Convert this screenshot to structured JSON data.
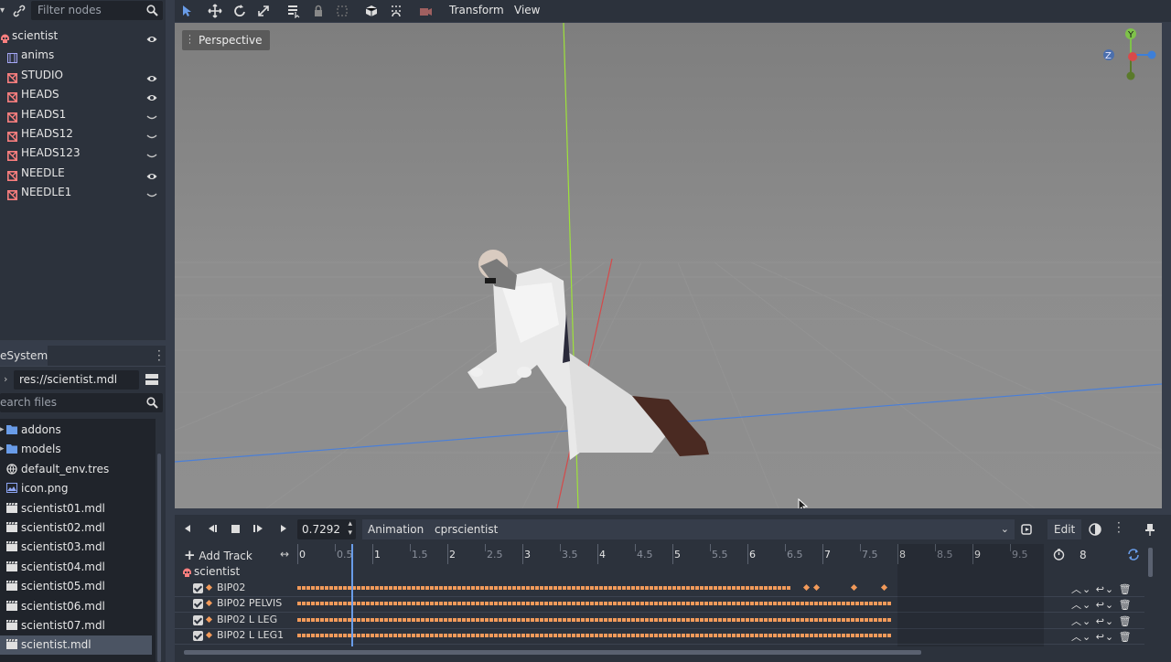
{
  "scene": {
    "filter_placeholder": "Filter nodes",
    "nodes": [
      {
        "label": "scientist",
        "icon": "skeleton-icon",
        "vis": "eye"
      },
      {
        "label": "anims",
        "icon": "animation-player-icon",
        "vis": ""
      },
      {
        "label": "STUDIO",
        "icon": "mesh-icon",
        "vis": "eye"
      },
      {
        "label": "HEADS",
        "icon": "mesh-icon",
        "vis": "eye"
      },
      {
        "label": "HEADS1",
        "icon": "mesh-icon",
        "vis": "hidden"
      },
      {
        "label": "HEADS12",
        "icon": "mesh-icon",
        "vis": "hidden"
      },
      {
        "label": "HEADS123",
        "icon": "mesh-icon",
        "vis": "hidden"
      },
      {
        "label": "NEEDLE",
        "icon": "mesh-icon",
        "vis": "eye"
      },
      {
        "label": "NEEDLE1",
        "icon": "mesh-icon",
        "vis": "hidden"
      }
    ]
  },
  "filesystem": {
    "tab": "eSystem",
    "path": "res://scientist.mdl",
    "search_placeholder": "earch files",
    "items": [
      {
        "label": "addons",
        "type": "folder",
        "selected": false
      },
      {
        "label": "models",
        "type": "folder",
        "selected": false
      },
      {
        "label": "default_env.tres",
        "type": "resource",
        "selected": false
      },
      {
        "label": "icon.png",
        "type": "image",
        "selected": false
      },
      {
        "label": "scientist01.mdl",
        "type": "scene",
        "selected": false
      },
      {
        "label": "scientist02.mdl",
        "type": "scene",
        "selected": false
      },
      {
        "label": "scientist03.mdl",
        "type": "scene",
        "selected": false
      },
      {
        "label": "scientist04.mdl",
        "type": "scene",
        "selected": false
      },
      {
        "label": "scientist05.mdl",
        "type": "scene",
        "selected": false
      },
      {
        "label": "scientist06.mdl",
        "type": "scene",
        "selected": false
      },
      {
        "label": "scientist07.mdl",
        "type": "scene",
        "selected": false
      },
      {
        "label": "scientist.mdl",
        "type": "scene",
        "selected": true
      }
    ]
  },
  "viewport": {
    "menus": {
      "transform": "Transform",
      "view": "View"
    },
    "perspective_label": "Perspective",
    "gizmo": {
      "y": "Y",
      "z": "Z"
    }
  },
  "animation": {
    "time_value": "0.7292",
    "animation_label": "Animation",
    "current_animation": "cprscientist",
    "edit_label": "Edit",
    "add_track_label": "Add Track",
    "length_value": "8",
    "root_label": "scientist",
    "ticks": [
      "0",
      "0.5",
      "1",
      "1.5",
      "2",
      "2.5",
      "3",
      "3.5",
      "4",
      "4.5",
      "5",
      "5.5",
      "6",
      "6.5",
      "7",
      "7.5",
      "8",
      "8.5",
      "9",
      "9.5"
    ],
    "playhead_time": 0.7292,
    "tracks": [
      "BIP02",
      "BIP02 PELVIS",
      "BIP02 L LEG",
      "BIP02 L LEG1"
    ]
  },
  "colors": {
    "accent": "#699ce8",
    "keyframe": "#f29a5a",
    "mesh_icon": "#fc7f7f"
  }
}
